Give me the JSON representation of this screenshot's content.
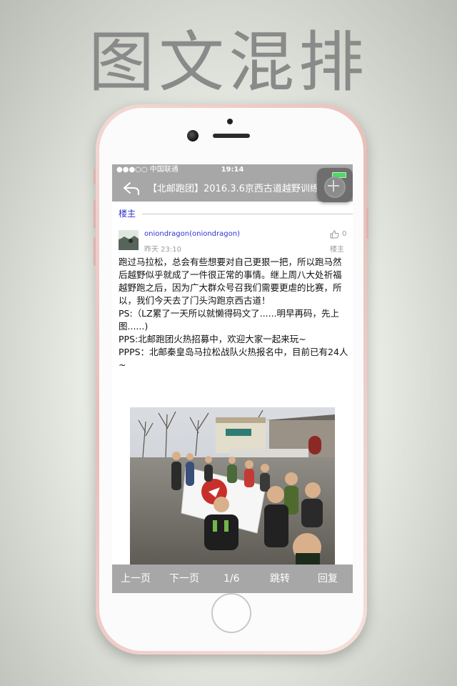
{
  "headline": "图文混排",
  "status_bar": {
    "carrier": "●●●○○ 中国联通",
    "time": "19:14"
  },
  "nav": {
    "back_icon": "back-arrow-icon",
    "title": "【北邮跑团】2016.3.6京西古道越野训练"
  },
  "floating_button": {
    "icon": "plus-icon"
  },
  "thread": {
    "owner_label": "楼主",
    "post": {
      "username": "oniondragon(oniondragon)",
      "time": "昨天 23:10",
      "like_icon": "thumbs-up-icon",
      "like_count": "0",
      "floor": "楼主",
      "paragraphs": [
        "跑过马拉松，总会有些想要对自己更狠一把，所以跑马然后越野似乎就成了一件很正常的事情。继上周八大处祈福越野跑之后，因为广大群众号召我们需要更虐的比赛，所以，我们今天去了门头沟跑京西古道！",
        "PS:（LZ累了一天所以就懒得码文了......明早再码，先上图......)",
        "PPS:北邮跑团火热招募中，欢迎大家一起来玩~",
        "PPPS：北邮秦皇岛马拉松战队火热报名中，目前已有24人~"
      ]
    }
  },
  "bottom_bar": {
    "prev": "上一页",
    "next": "下一页",
    "page": "1/6",
    "jump": "跳转",
    "reply": "回复"
  }
}
